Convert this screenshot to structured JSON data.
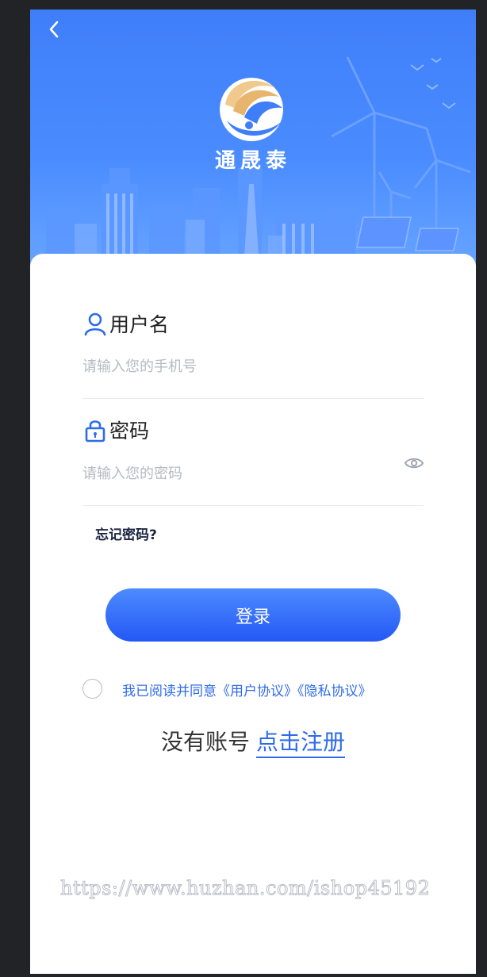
{
  "header": {
    "brand_name": "通晟泰",
    "back_icon": "chevron-left-icon",
    "logo_icon": "brand-logo-icon"
  },
  "form": {
    "username": {
      "label": "用户名",
      "icon": "user-icon",
      "placeholder": "请输入您的手机号",
      "value": ""
    },
    "password": {
      "label": "密码",
      "icon": "lock-icon",
      "placeholder": "请输入您的密码",
      "value": "",
      "toggle_icon": "eye-icon"
    },
    "forgot_label": "忘记密码?",
    "login_label": "登录"
  },
  "agreement": {
    "checked": false,
    "prefix": "我已阅读并同意",
    "user_agreement": "《用户协议》",
    "privacy_policy": "《隐私协议》"
  },
  "register": {
    "prompt": "没有账号",
    "link": "点击注册"
  },
  "watermark": "https://www.huzhan.com/ishop45192",
  "colors": {
    "accent": "#2f6be8",
    "hero_blue": "#4a8cff",
    "button_top": "#4d8bff",
    "button_bottom": "#2458f5"
  }
}
